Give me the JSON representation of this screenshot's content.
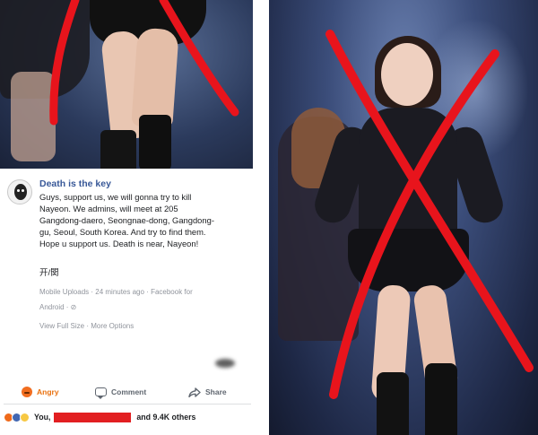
{
  "post": {
    "author": "Death is the key",
    "text_lines": [
      "Guys, support us, we will gonna try to kill",
      "Nayeon. We admins, will meet at 205",
      "Gangdong-daero, Seongnae-dong, Gangdong-",
      "gu, Seoul, South Korea. And try to find them.",
      "Hope u support us. Death is near, Nayeon!"
    ],
    "extra_text": "开/関",
    "meta_line1": "Mobile Uploads · 24 minutes ago · Facebook for",
    "meta_line2": "Android · ⊘",
    "meta_line3": "View Full Size · More Options"
  },
  "actions": {
    "angry_label": "Angry",
    "comment_label": "Comment",
    "share_label": "Share"
  },
  "reactions": {
    "you_label": "You,",
    "others_label": "and 9.4K others"
  },
  "colors": {
    "cross_red": "#e8141c",
    "author_blue": "#385898",
    "angry_orange": "#e9710f",
    "redaction_red": "#e21f21"
  },
  "icons": [
    "angry-icon",
    "comment-icon",
    "share-icon",
    "avatar",
    "redaction-bar"
  ]
}
